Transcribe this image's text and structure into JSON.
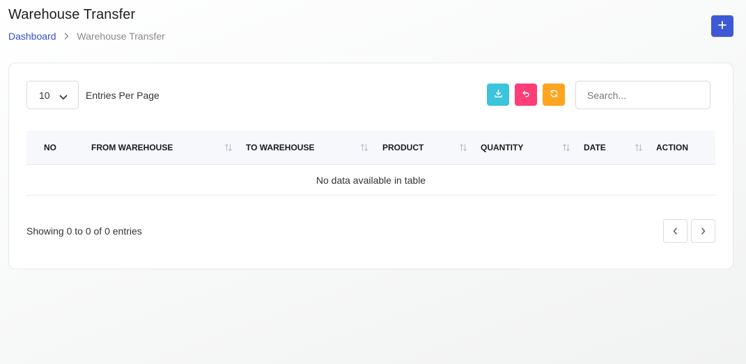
{
  "header": {
    "title": "Warehouse Transfer",
    "breadcrumb": [
      {
        "label": "Dashboard"
      },
      {
        "label": "Warehouse Transfer"
      }
    ],
    "add_icon": "plus-icon"
  },
  "controls": {
    "entries_value": "10",
    "entries_label": "Entries Per Page",
    "search_placeholder": "Search...",
    "tool_buttons": [
      {
        "icon": "download-icon",
        "color": "#3cc3dd"
      },
      {
        "icon": "undo-icon",
        "color": "#ff3d78"
      },
      {
        "icon": "refresh-icon",
        "color": "#ffa41f"
      }
    ]
  },
  "table": {
    "columns": [
      "NO",
      "FROM WAREHOUSE",
      "TO WAREHOUSE",
      "PRODUCT",
      "QUANTITY",
      "DATE",
      "ACTION"
    ],
    "empty_message": "No data available in table"
  },
  "footer": {
    "info": "Showing 0 to 0 of 0 entries"
  },
  "colors": {
    "primary": "#3d59d6",
    "link": "#3550c7",
    "download": "#3cc3dd",
    "undo": "#ff3d78",
    "refresh": "#ffa41f"
  }
}
